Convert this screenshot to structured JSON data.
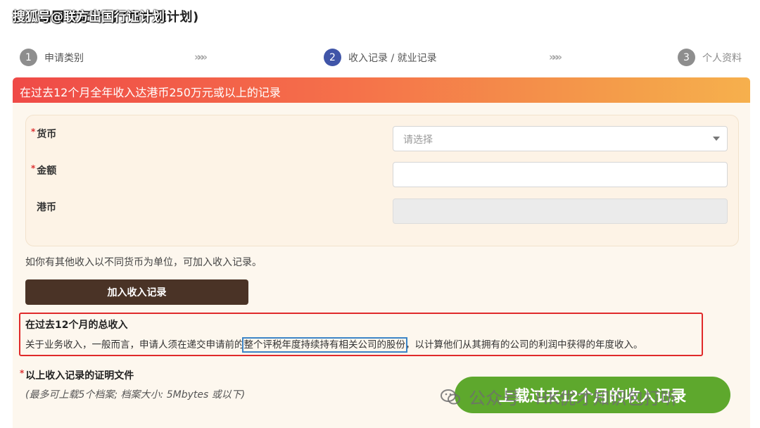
{
  "page": {
    "title": "联方出国行证计划 (高才通计划)",
    "watermark_top": "搜狐号@联方出国行证计划",
    "watermark_bottom": "公众号 · HK优才知识包打听"
  },
  "steps": [
    {
      "number": "1",
      "label": "申请类别"
    },
    {
      "number": "2",
      "label": "收入记录 / 就业记录"
    },
    {
      "number": "3",
      "label": "个人资料"
    }
  ],
  "step_arrow": "»»»",
  "banner": {
    "text": "在过去12个月全年收入达港币250万元或以上的记录"
  },
  "form": {
    "required_mark": "*",
    "currency_label": "货币",
    "currency_placeholder": "请选择",
    "amount_label": "金额",
    "amount_value": "",
    "hkd_label": "港币"
  },
  "hint": "如你有其他收入以不同货币为单位，可加入收入记录。",
  "add_button": "加入收入记录",
  "info": {
    "title": "在过去12个月的总收入",
    "body_before": "关于业务收入，一般而言，申请人须在递交申请前的",
    "body_highlight": "整个评税年度持续持有相关公司的股份",
    "body_after": "，以计算他们从其拥有的公司的利润中获得的年度收入。"
  },
  "proof": {
    "title": "以上收入记录的证明文件",
    "subtitle": "(最多可上载5个档案; 档案大小: 5Mbytes 或以下)"
  },
  "upload_button": "上载过去12个月的收入记录",
  "colors": {
    "banner_start": "#ef4a47",
    "banner_end": "#f6b04d",
    "active_step": "#4055a8",
    "add_button_bg": "#4a3326",
    "upload_button_bg": "#5ea82d",
    "info_border": "#e02a2a",
    "highlight_border": "#3c84c6"
  }
}
